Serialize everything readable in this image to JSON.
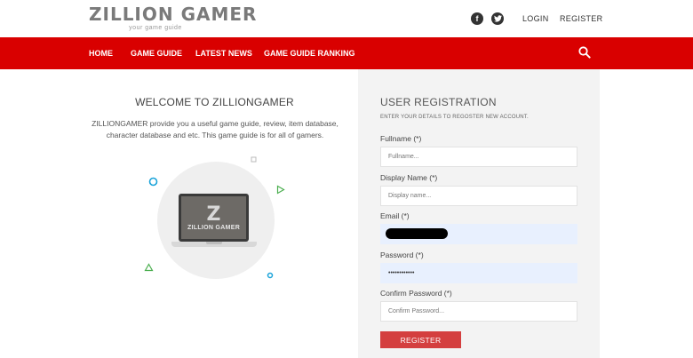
{
  "header": {
    "logo_main": "ZILLION GAMER",
    "logo_sub": "your game guide",
    "facebook_glyph": "f",
    "login": "LOGIN",
    "register": "REGISTER"
  },
  "nav": {
    "items": [
      "HOME",
      "GAME GUIDE",
      "LATEST NEWS",
      "GAME GUIDE RANKING"
    ]
  },
  "welcome": {
    "title": "WELCOME TO ZILLIONGAMER",
    "text": "ZILLIONGAMER provide you a useful game guide, review, item database, character database and etc. This game guide is for all of gamers.",
    "laptop_logo_glyph": "Z",
    "laptop_logo_text": "ZILLION GAMER"
  },
  "form": {
    "title": "USER REGISTRATION",
    "subtitle": "ENTER YOUR DETAILS TO REGOSTER NEW ACCOUNT.",
    "fullname_label": "Fullname (*)",
    "fullname_placeholder": "Fullname...",
    "display_label": "Display Name (*)",
    "display_placeholder": "Display name...",
    "email_label": "Email (*)",
    "password_label": "Password (*)",
    "password_value": "••••••••••••",
    "confirm_label": "Confirm Password (*)",
    "confirm_placeholder": "Confirm Password...",
    "submit": "REGISTER"
  },
  "colors": {
    "brand_red": "#d90000",
    "button_red": "#d43f3f",
    "panel_bg": "#f3f3f3",
    "autofill_bg": "#e8f0fe"
  },
  "icons": {
    "facebook": "facebook-icon",
    "twitter": "twitter-icon",
    "search": "search-icon"
  }
}
